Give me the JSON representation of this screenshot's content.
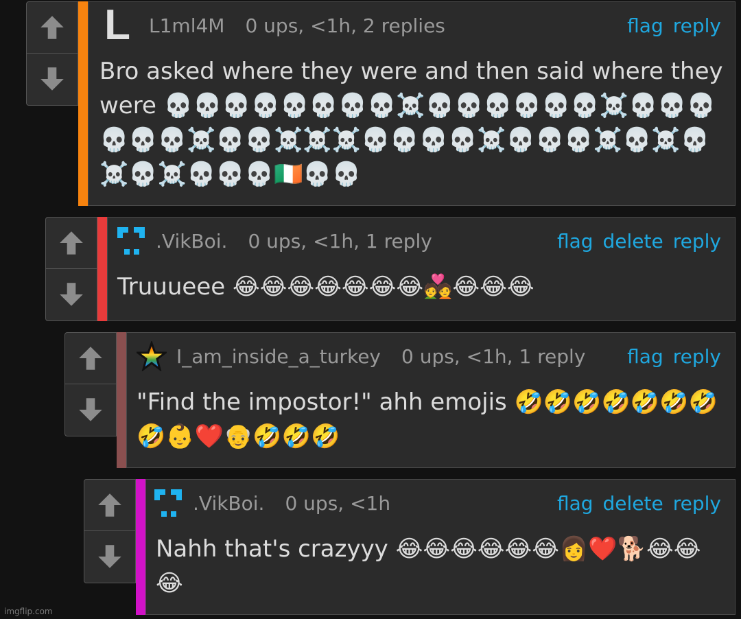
{
  "comments": [
    {
      "username": "L1ml4M",
      "avatar_letter": "L",
      "meta": "0 ups, <1h, 2 replies",
      "actions": [
        "flag",
        "reply"
      ],
      "text": "Bro asked where they were and then said where they were 💀💀💀💀💀💀💀💀☠️💀💀💀💀💀💀☠️💀💀💀💀💀💀☠️💀💀☠️☠️☠️💀💀💀💀☠️💀💀💀☠️💀☠️💀☠️💀☠️💀💀💀🇮🇪💀💀",
      "bar_color": "#f7830f"
    },
    {
      "username": ".VikBoi.",
      "meta": "0 ups, <1h, 1 reply",
      "actions": [
        "flag",
        "delete",
        "reply"
      ],
      "text": "Truuueee 😂😂😂😂😂😂😂💑😂😂😂",
      "bar_color": "#e83b3b"
    },
    {
      "username": "I_am_inside_a_turkey",
      "meta": "0 ups, <1h, 1 reply",
      "actions": [
        "flag",
        "reply"
      ],
      "text": "\"Find the impostor!\" ahh emojis 🤣🤣🤣🤣🤣🤣🤣🤣👶❤️👴🤣🤣🤣",
      "bar_color": "#8a4f4f"
    },
    {
      "username": ".VikBoi.",
      "meta": "0 ups, <1h",
      "actions": [
        "flag",
        "delete",
        "reply"
      ],
      "text": "Nahh that's crazyyy 😂😂😂😂😂😂👩❤️🐕😂😂😂",
      "bar_color": "#d112c7"
    }
  ],
  "watermark": "imgflip.com"
}
